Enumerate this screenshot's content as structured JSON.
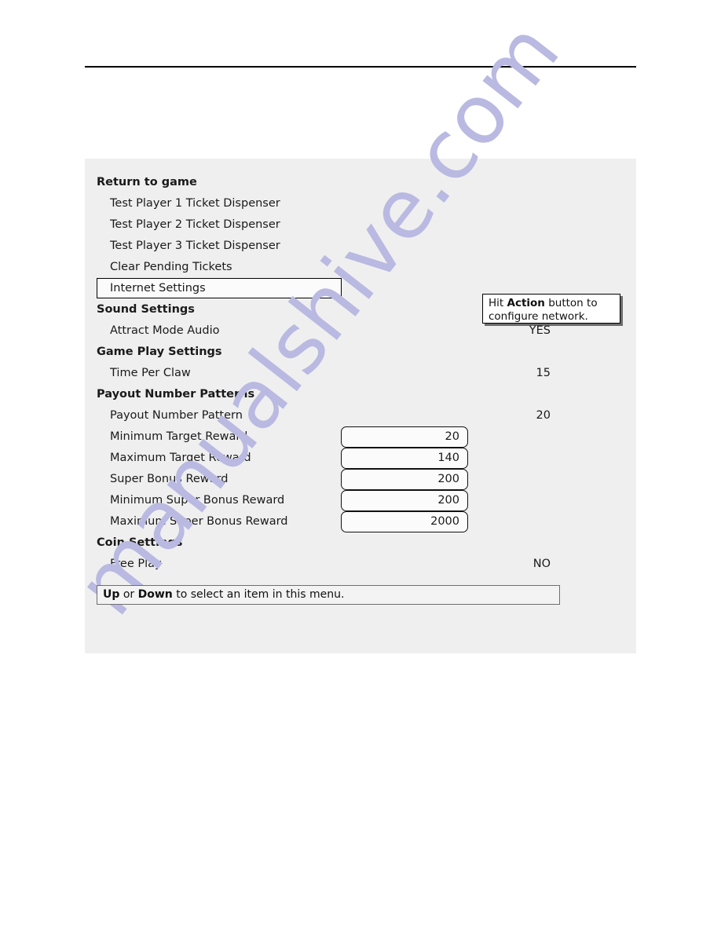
{
  "watermark": {
    "text": "manualshive.com",
    "color": "#b9b9e2"
  },
  "panel": {
    "background": "#efefef",
    "rows": [
      {
        "type": "header",
        "label": "Return to game",
        "value": ""
      },
      {
        "type": "item",
        "label": "Test Player 1 Ticket Dispenser",
        "value": ""
      },
      {
        "type": "item",
        "label": "Test Player 2 Ticket Dispenser",
        "value": ""
      },
      {
        "type": "item",
        "label": "Test Player 3 Ticket Dispenser",
        "value": ""
      },
      {
        "type": "item",
        "label": "Clear Pending Tickets",
        "value": ""
      },
      {
        "type": "selected",
        "label": "Internet Settings",
        "value": ""
      },
      {
        "type": "header",
        "label": "Sound Settings",
        "value": ""
      },
      {
        "type": "item",
        "label": "Attract Mode Audio",
        "value": "YES"
      },
      {
        "type": "header",
        "label": "Game Play Settings",
        "value": ""
      },
      {
        "type": "item",
        "label": "Time Per Claw",
        "value": "15"
      },
      {
        "type": "header",
        "label": "Payout Number Patterns",
        "value": ""
      },
      {
        "type": "item",
        "label": "Payout Number Pattern",
        "value": "20"
      },
      {
        "type": "boxed",
        "label": "Minimum Target Reward",
        "value": "20"
      },
      {
        "type": "boxed",
        "label": "Maximum Target Reward",
        "value": "140"
      },
      {
        "type": "boxed",
        "label": "Super Bonus Reward",
        "value": "200"
      },
      {
        "type": "boxed",
        "label": "Minimum Super Bonus Reward",
        "value": "200"
      },
      {
        "type": "boxed",
        "label": "Maximum Super Bonus Reward",
        "value": "2000"
      },
      {
        "type": "header",
        "label": "Coin Settings",
        "value": ""
      },
      {
        "type": "item",
        "label": "Free Play",
        "value": "NO"
      }
    ]
  },
  "tooltip": {
    "prefix": "Hit ",
    "emphasis": "Action",
    "suffix": " button to configure network."
  },
  "hint_bar": {
    "key_up": "Up",
    "conjunction": " or ",
    "key_down": "Down",
    "text": " to select an item in this menu."
  }
}
